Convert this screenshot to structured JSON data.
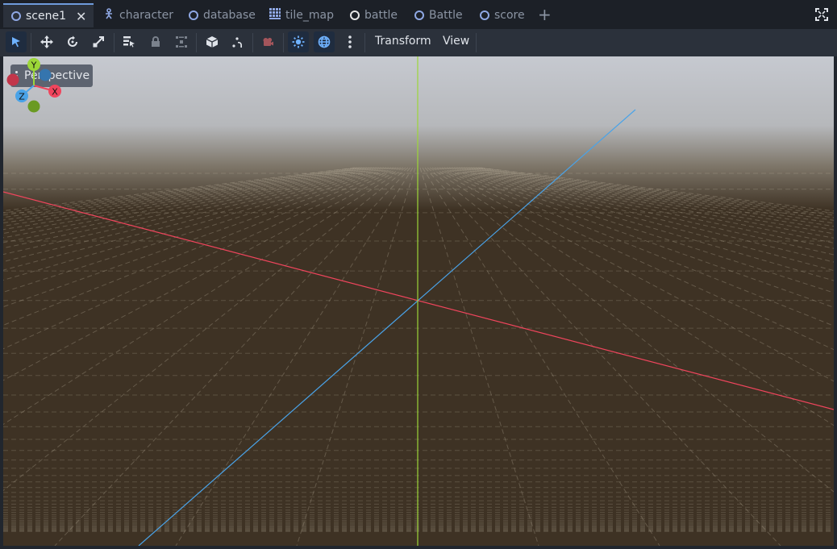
{
  "tabs": [
    {
      "label": "scene1",
      "icon": "node3d-ring-icon",
      "active": true
    },
    {
      "label": "character",
      "icon": "skeleton-icon",
      "active": false
    },
    {
      "label": "database",
      "icon": "node3d-ring-icon",
      "active": false
    },
    {
      "label": "tile_map",
      "icon": "grid-icon",
      "active": false
    },
    {
      "label": "battle",
      "icon": "node-ring-white-icon",
      "active": false
    },
    {
      "label": "Battle",
      "icon": "node3d-ring-icon",
      "active": false
    },
    {
      "label": "score",
      "icon": "node3d-ring-icon",
      "active": false
    }
  ],
  "toolbar": {
    "tools": [
      "select-tool-icon",
      "move-tool-icon",
      "rotate-tool-icon",
      "scale-tool-icon",
      "list-select-icon",
      "lock-icon",
      "group-icon",
      "snap-object-icon",
      "ruler-icon",
      "camera-preview-icon",
      "sun-preview-icon",
      "environment-preview-icon",
      "more-options-icon"
    ],
    "transform_label": "Transform",
    "view_label": "View"
  },
  "viewport": {
    "view_mode_label": "Perspective",
    "gizmo_axes": {
      "x": "X",
      "y": "Y",
      "z": "Z"
    }
  },
  "colors": {
    "x_axis": "#f0455d",
    "y_axis": "#9cd638",
    "z_axis": "#4aa3e8",
    "ground": "#3e3224",
    "sky_top": "#c9ccd3",
    "accent": "#6f9bdc"
  }
}
